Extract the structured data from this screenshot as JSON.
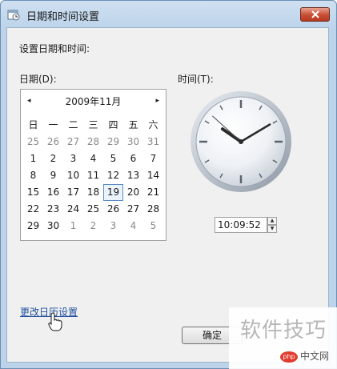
{
  "window": {
    "title": "日期和时间设置"
  },
  "dialog": {
    "heading": "设置日期和时间:",
    "date_label": "日期(D):",
    "time_label": "时间(T):"
  },
  "calendar": {
    "month_title": "2009年11月",
    "prev_symbol": "◂",
    "next_symbol": "▸",
    "weekdays": [
      "日",
      "一",
      "二",
      "三",
      "四",
      "五",
      "六"
    ],
    "weeks": [
      [
        "25",
        "26",
        "27",
        "28",
        "29",
        "30",
        "31"
      ],
      [
        "1",
        "2",
        "3",
        "4",
        "5",
        "6",
        "7"
      ],
      [
        "8",
        "9",
        "10",
        "11",
        "12",
        "13",
        "14"
      ],
      [
        "15",
        "16",
        "17",
        "18",
        "19",
        "20",
        "21"
      ],
      [
        "22",
        "23",
        "24",
        "25",
        "26",
        "27",
        "28"
      ],
      [
        "29",
        "30",
        "1",
        "2",
        "3",
        "4",
        "5"
      ]
    ],
    "selected_day": "19"
  },
  "clock": {
    "hour": 10,
    "minute": 9,
    "second": 52
  },
  "time_field": {
    "value": "10:09:52"
  },
  "links": {
    "change_calendar": "更改日历设置"
  },
  "buttons": {
    "ok": "确定"
  },
  "watermark": {
    "text": "软件技巧",
    "logo_badge": "php",
    "logo_text": "中文网"
  },
  "colors": {
    "title_bar": "#bcd3ea",
    "close_button": "#c84d34",
    "link": "#1f4f9e",
    "selected_day_border": "#5a8cc8"
  },
  "icons": {
    "app": "date-time-icon",
    "close": "close-icon",
    "cursor": "hand-pointer-icon"
  }
}
